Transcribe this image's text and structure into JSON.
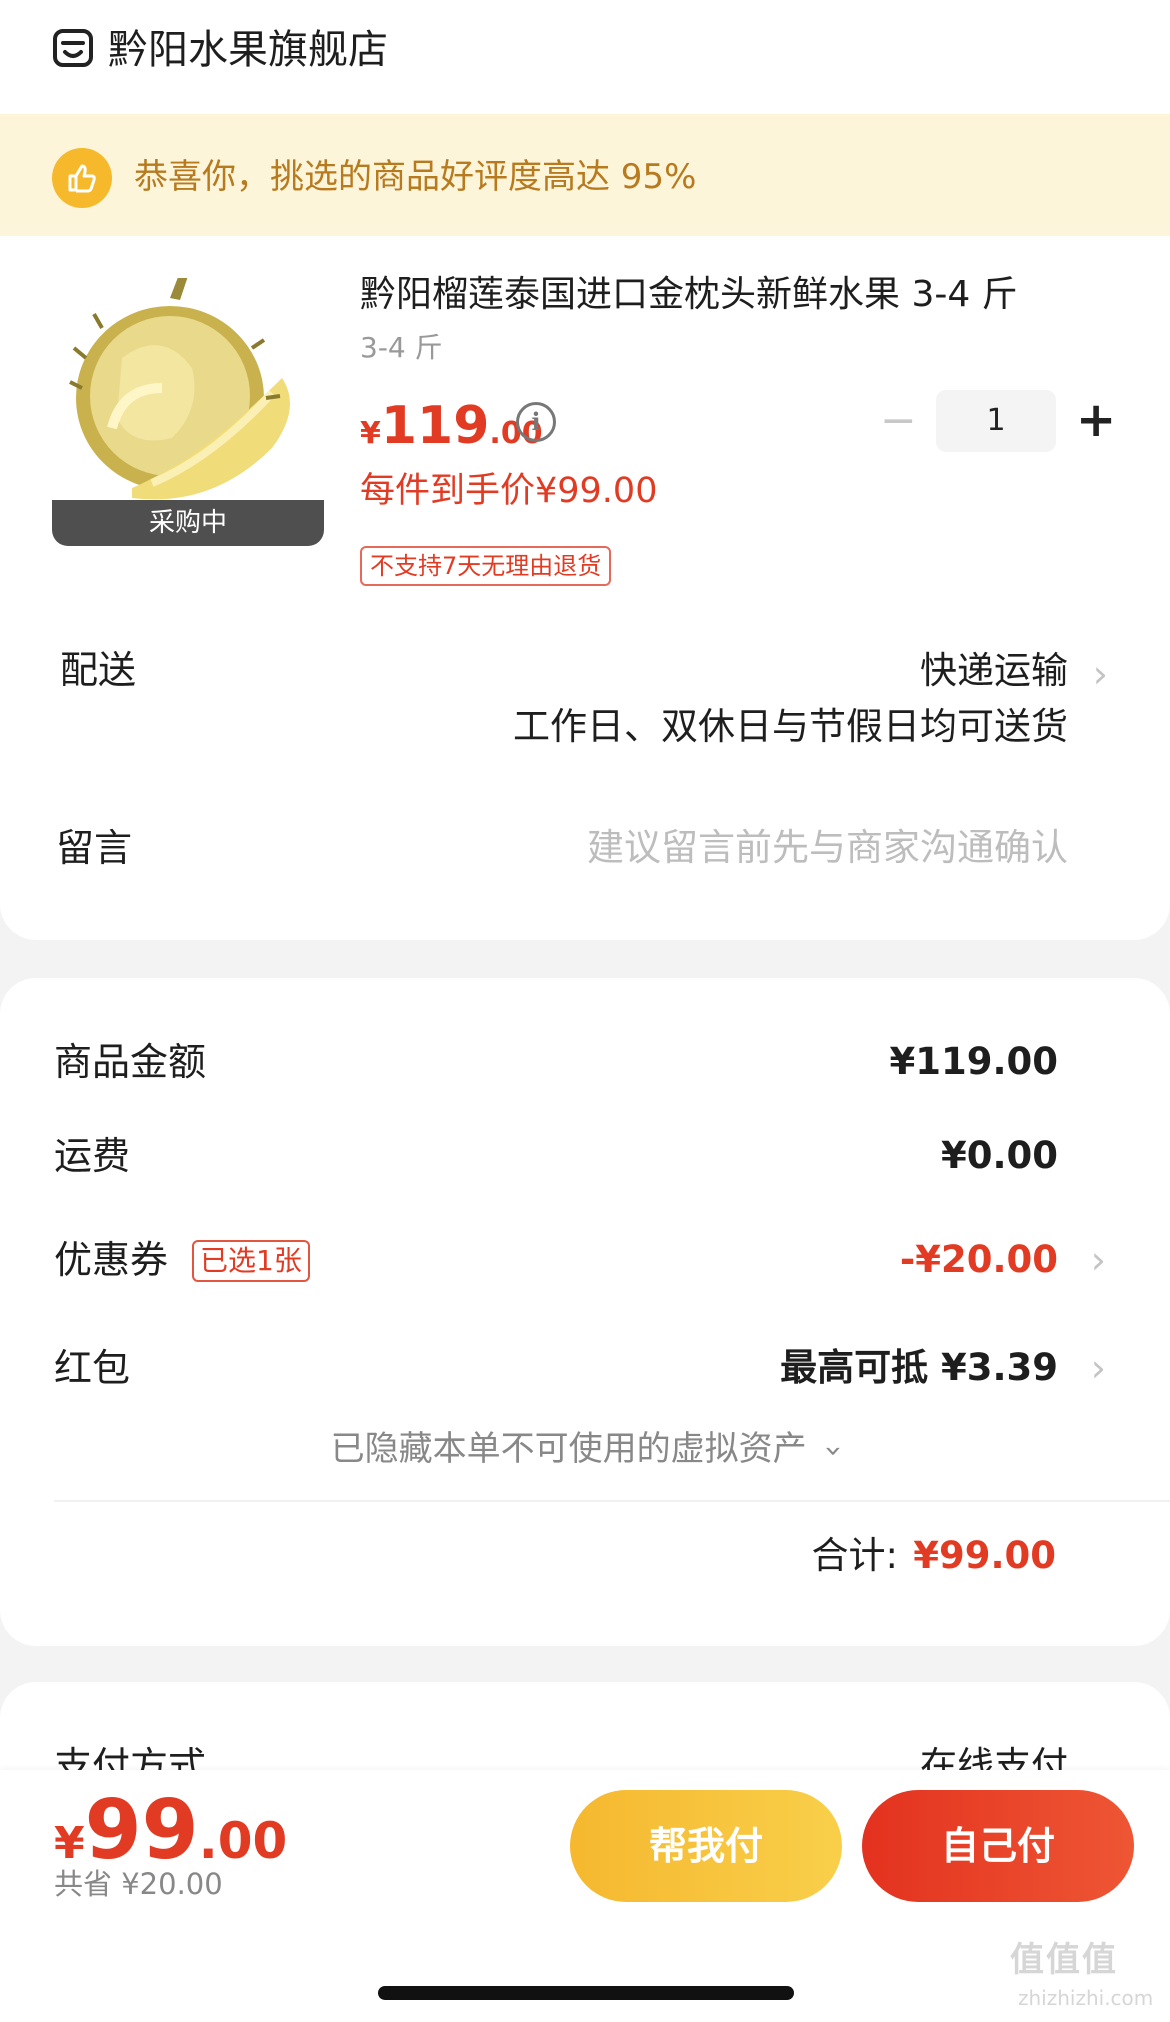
{
  "store": {
    "name": "黔阳水果旗舰店",
    "icon": "store-icon"
  },
  "banner": {
    "text": "恭喜你，挑选的商品好评度高达 95%",
    "icon": "thumbs-up-icon"
  },
  "product": {
    "title": "黔阳榴莲泰国进口金枕头新鲜水果 3-4 斤",
    "spec": "3-4 斤",
    "image_tag": "采购中",
    "price_symbol": "¥",
    "price_int": "119",
    "price_dec": ".00",
    "unit_price": "每件到手价¥99.00",
    "no_return": "不支持7天无理由退货",
    "quantity": "1",
    "minus": "−",
    "plus": "+"
  },
  "shipping": {
    "label": "配送",
    "value": "快递运输",
    "sub": "工作日、双休日与节假日均可送货"
  },
  "message": {
    "label": "留言",
    "placeholder": "建议留言前先与商家沟通确认"
  },
  "summary": {
    "goods_label": "商品金额",
    "goods_value": "¥119.00",
    "freight_label": "运费",
    "freight_value": "¥0.00",
    "coupon_label": "优惠券",
    "coupon_tag": "已选1张",
    "coupon_value": "-¥20.00",
    "redpacket_label": "红包",
    "redpacket_value": "最高可抵 ¥3.39",
    "hidden_note": "已隐藏本单不可使用的虚拟资产",
    "total_label": "合计:",
    "total_value": "¥99.00"
  },
  "payment": {
    "label": "支付方式",
    "value": "在线支付"
  },
  "bottom": {
    "symbol": "¥",
    "int": "99",
    "dec": ".00",
    "saved": "共省 ¥20.00",
    "help_pay": "帮我付",
    "self_pay": "自己付"
  },
  "watermark": {
    "main": "值值值",
    "sub": "zhizhizhi.com"
  },
  "colors": {
    "accent": "#e23b24",
    "banner_bg": "#fdf5da",
    "banner_text": "#b77a1f",
    "gold": "#f6b92c"
  }
}
